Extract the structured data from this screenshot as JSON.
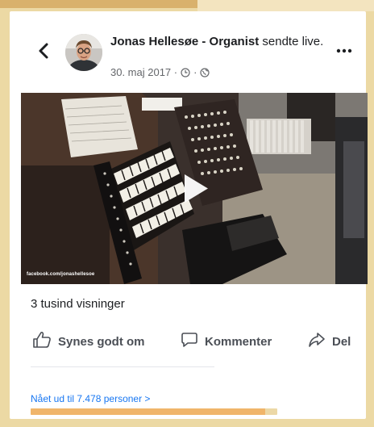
{
  "post": {
    "author": "Jonas Hellesøe - Organist",
    "action": "sendte live.",
    "date": "30. maj 2017 · ",
    "separator": " · "
  },
  "video": {
    "watermark": "facebook.com/jonashellesoe",
    "play_icon": "play-icon"
  },
  "stats": {
    "views": "3 tusind visninger"
  },
  "actions": {
    "like": "Synes godt om",
    "comment": "Kommenter",
    "share": "Del"
  },
  "reach": {
    "label": "Nået ud til 7.478 personer >",
    "progress_fraction": 0.95
  },
  "icons": {
    "back": "chevron-left-icon",
    "more": "more-dots-icon",
    "clock": "clock-icon",
    "globe": "globe-icon",
    "like": "thumbs-up-icon",
    "comment": "comment-bubble-icon",
    "share": "share-arrow-icon"
  },
  "colors": {
    "link": "#1877f2",
    "muted": "#65676b",
    "progress": "#f0b56a"
  }
}
